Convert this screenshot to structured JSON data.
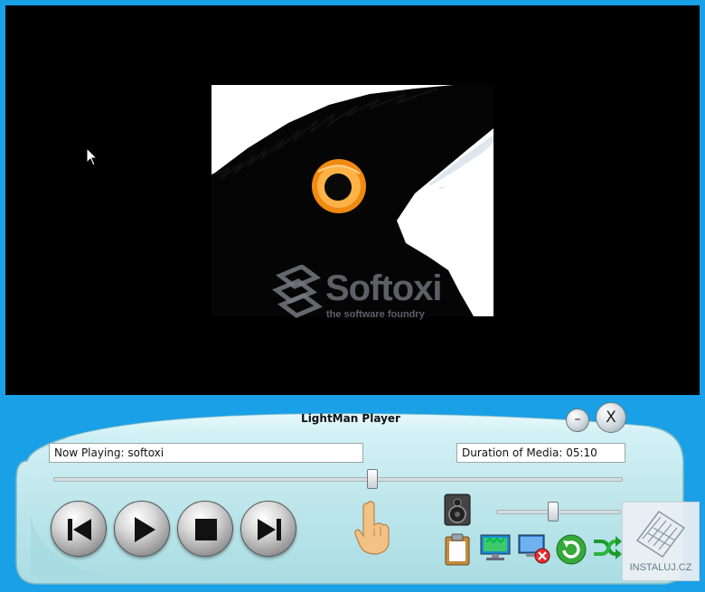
{
  "player": {
    "title": "LightMan Player",
    "minimize_label": "–",
    "close_label": "X",
    "now_playing": "Now Playing: softoxi",
    "duration": "Duration of Media: 05:10",
    "seek_progress": 0.56,
    "volume_level": 0.46
  },
  "video": {
    "watermark_title": "Softoxi",
    "watermark_subtitle": "the software foundry"
  },
  "controls": [
    "previous-track",
    "play",
    "stop",
    "next-track"
  ],
  "tools": [
    "speaker-icon",
    "clipboard-icon",
    "screen-icon",
    "monitor-close-icon",
    "refresh-icon",
    "shuffle-icon"
  ],
  "badge": {
    "text": "INSTALUJ.CZ"
  },
  "colors": {
    "window_background": "#1aa0e6",
    "video_background": "#000000",
    "panel": "#bfe7ec",
    "eye": "#f08a10"
  }
}
